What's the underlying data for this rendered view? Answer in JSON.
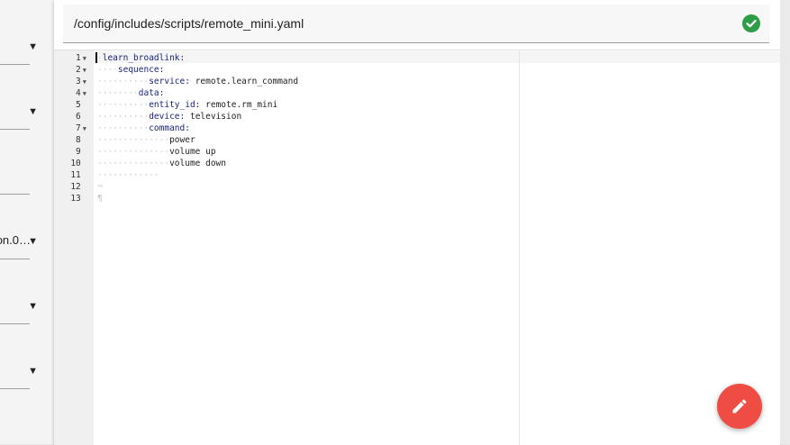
{
  "sidebar": {
    "items": [
      {
        "text": "",
        "arrow": "▼"
      },
      {
        "text": "",
        "arrow": "▼"
      },
      {
        "text": "",
        "arrow": ""
      },
      {
        "text": "on.0…",
        "arrow": "▼"
      },
      {
        "text": "",
        "arrow": "▼"
      },
      {
        "text": "",
        "arrow": "▼"
      }
    ]
  },
  "header": {
    "path": "/config/includes/scripts/remote_mini.yaml",
    "status_icon": "check-circle-icon",
    "status_color": "#2e9d48"
  },
  "editor": {
    "line_numbers": [
      "1",
      "2",
      "3",
      "4",
      "5",
      "6",
      "7",
      "8",
      "9",
      "10",
      "11",
      "12",
      "13"
    ],
    "lines": [
      {
        "indent": "·",
        "key": "learn_broadlink:",
        "value": ""
      },
      {
        "indent": "····",
        "key": "sequence:",
        "value": ""
      },
      {
        "indent": "········-·",
        "key": "service:",
        "value": " remote.learn_command"
      },
      {
        "indent": "········",
        "key": "data:",
        "value": ""
      },
      {
        "indent": "··········",
        "key": "entity_id:",
        "value": " remote.rm_mini"
      },
      {
        "indent": "··········",
        "key": "device:",
        "value": " television"
      },
      {
        "indent": "··········",
        "key": "command:",
        "value": ""
      },
      {
        "indent": "············-·",
        "key": "",
        "value": "power"
      },
      {
        "indent": "············-·",
        "key": "",
        "value": "volume up"
      },
      {
        "indent": "············-·",
        "key": "",
        "value": "volume down"
      },
      {
        "indent": "············",
        "key": "",
        "value": ""
      },
      {
        "indent": "¬",
        "key": "",
        "value": ""
      },
      {
        "indent": "¶",
        "key": "",
        "value": ""
      }
    ]
  },
  "fab": {
    "icon": "pencil-icon",
    "color": "#ef4c43"
  }
}
